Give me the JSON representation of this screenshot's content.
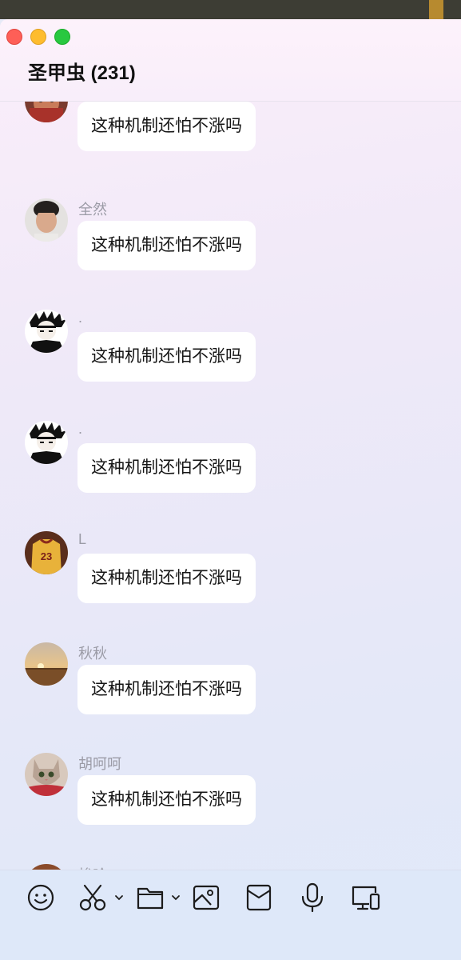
{
  "window": {
    "title": "圣甲虫 (231)"
  },
  "messages": [
    {
      "sender": "",
      "text": "这种机制还怕不涨吗",
      "avatar": "avatar-partial"
    },
    {
      "sender": "全然",
      "text": "这种机制还怕不涨吗",
      "avatar": "avatar-boy-photo"
    },
    {
      "sender": ".",
      "text": "这种机制还怕不涨吗",
      "avatar": "avatar-anime-drawing"
    },
    {
      "sender": ".",
      "text": "这种机制还怕不涨吗",
      "avatar": "avatar-anime-drawing"
    },
    {
      "sender": "L",
      "text": "这种机制还怕不涨吗",
      "avatar": "avatar-jersey-23"
    },
    {
      "sender": "秋秋",
      "text": "这种机制还怕不涨吗",
      "avatar": "avatar-sunset"
    },
    {
      "sender": "胡呵呵",
      "text": "这种机制还怕不涨吗",
      "avatar": "avatar-cat"
    },
    {
      "sender": "梭哈",
      "text": "",
      "avatar": "avatar-cartoon-faces"
    }
  ],
  "jersey_number": "23",
  "toolbar": {
    "icons": [
      "emoji-icon",
      "scissors-icon",
      "folder-icon",
      "image-icon",
      "red-packet-icon",
      "microphone-icon",
      "screen-share-icon"
    ]
  },
  "colors": {
    "bubble": "#ffffff",
    "sender_name": "#9b9ba6",
    "close": "#fe5f57",
    "minimize": "#febc2e",
    "maximize": "#28c840"
  }
}
